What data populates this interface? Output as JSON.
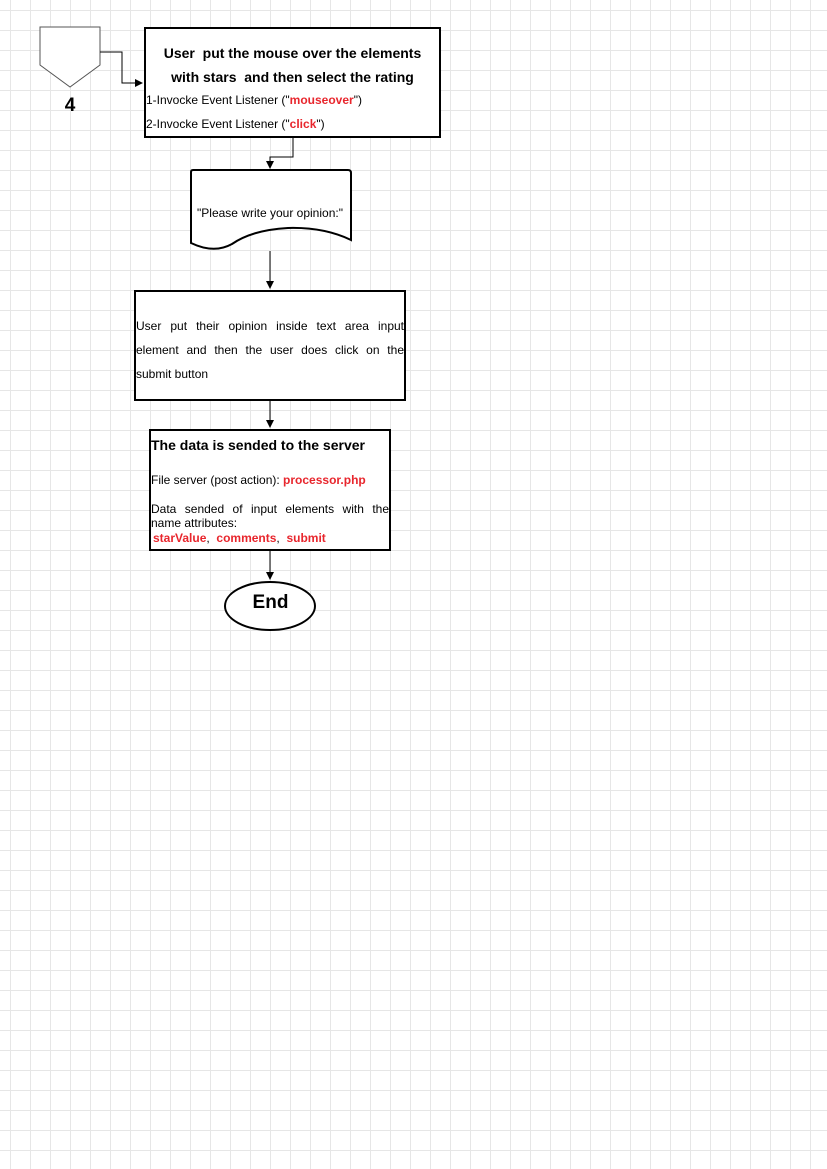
{
  "connector": {
    "number": "4"
  },
  "box1": {
    "title_line1": "User  put the mouse over the elements",
    "title_line2": "with stars  and then select the rating",
    "item1_prefix": "1-Invocke Event Listener (\"",
    "item1_event": "mouseover",
    "item1_suffix": "\")",
    "item2_prefix": "2-Invocke Event Listener (\"",
    "item2_event": "click",
    "item2_suffix": "\")"
  },
  "document": {
    "text": "\"Please write your opinion:\""
  },
  "box3": {
    "text": "User put their opinion inside text area input element and then the user does click on the submit button"
  },
  "box4": {
    "title": "The data is sended to the server",
    "file_label": "File server (post action): ",
    "file_value": "processor.php",
    "data_text": "Data sended of input elements with the name attributes:",
    "attr1": "starValue",
    "attr2": "comments",
    "attr3": "submit",
    "separator": ",  "
  },
  "terminal": {
    "label": "End"
  },
  "colors": {
    "highlight": "#e8262d",
    "grid": "#e6e6e6",
    "stroke": "#000000"
  }
}
